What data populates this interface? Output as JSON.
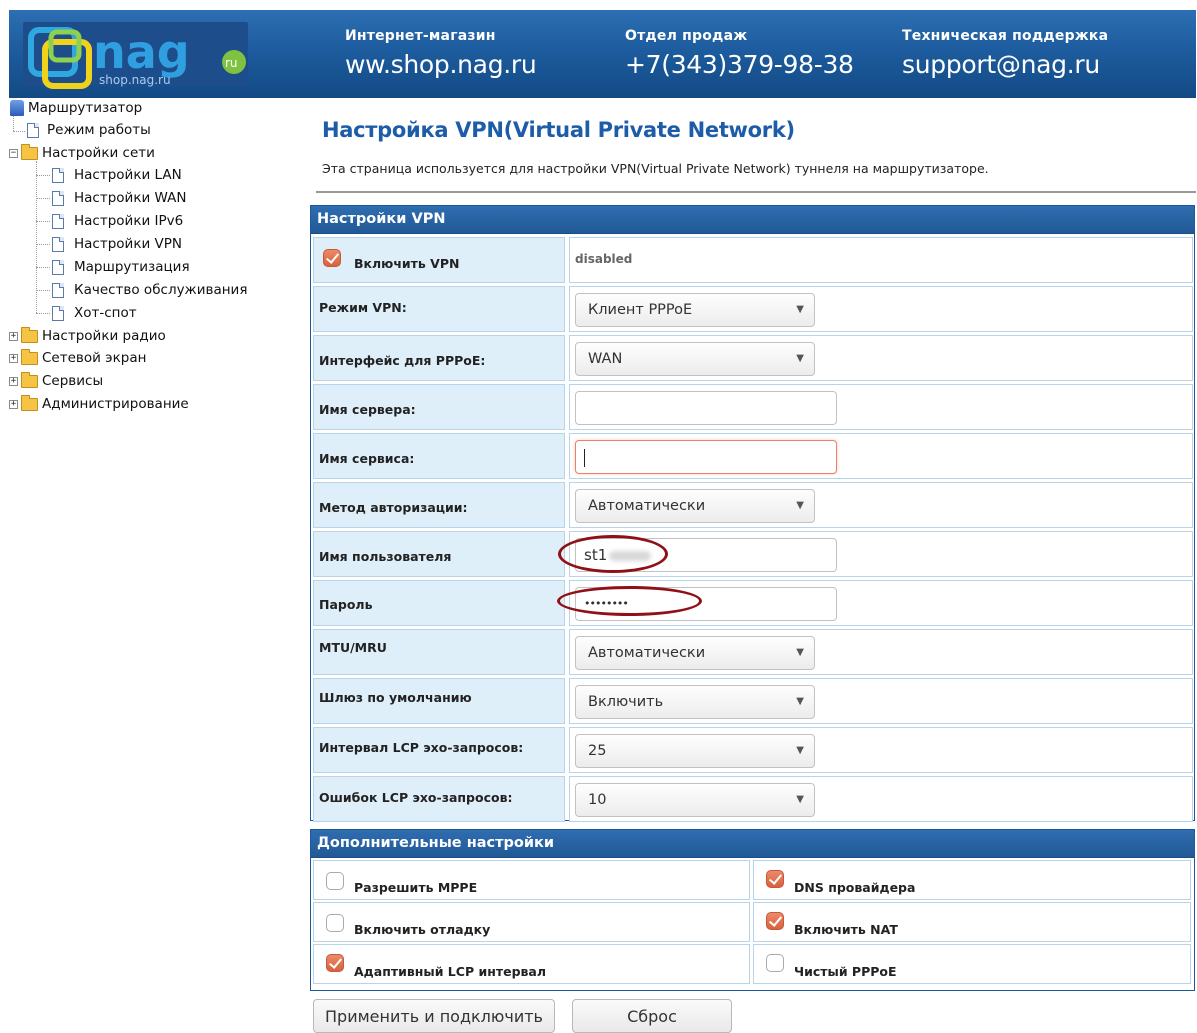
{
  "header": {
    "logo": {
      "brand": "nag",
      "subtext": "shop.nag.ru",
      "badge": "ru"
    },
    "shop": {
      "label": "Интернет-магазин",
      "value": "ww.shop.nag.ru"
    },
    "sales": {
      "label": "Отдел продаж",
      "value": "+7(343)379-98-38"
    },
    "support": {
      "label": "Техническая поддержка",
      "value": "support@nag.ru"
    }
  },
  "tree": {
    "root": "Маршрутизатор",
    "mode": "Режим работы",
    "net": "Настройки сети",
    "lan": "Настройки LAN",
    "wan": "Настройки WAN",
    "ipv6": "Настройки IPv6",
    "vpn": "Настройки VPN",
    "routing": "Маршрутизация",
    "qos": "Качество обслуживания",
    "hotspot": "Хот-спот",
    "radio": "Настройки радио",
    "firewall": "Сетевой экран",
    "services": "Сервисы",
    "admin": "Администрирование"
  },
  "page": {
    "title": "Настройка VPN(Virtual Private Network)",
    "description": "Эта страница используется для настройки VPN(Virtual Private Network) туннеля на маршрутизаторе."
  },
  "vpn": {
    "header": "Настройки VPN",
    "enable_label": "Включить VPN",
    "status": "disabled",
    "mode_label": "Режим VPN:",
    "mode_value": "Клиент PPPoE",
    "iface_label": "Интерфейс для PPPoE:",
    "iface_value": "WAN",
    "server_label": "Имя сервера:",
    "server_value": "",
    "service_label": "Имя сервиса:",
    "service_value": "",
    "auth_label": "Метод авторизации:",
    "auth_value": "Автоматически",
    "user_label": "Имя пользователя",
    "user_value": "st1",
    "pass_label": "Пароль",
    "pass_value": "••••••••",
    "mtu_label": "MTU/MRU",
    "mtu_value": "Автоматически",
    "gw_label": "Шлюз по умолчанию",
    "gw_value": "Включить",
    "lcp_int_label": "Интервал LCP эхо-запросов:",
    "lcp_int_value": "25",
    "lcp_err_label": "Ошибок LCP эхо-запросов:",
    "lcp_err_value": "10"
  },
  "extra": {
    "header": "Дополнительные настройки",
    "mppe": "Разрешить MPPE",
    "dns": "DNS провайдера",
    "debug": "Включить отладку",
    "nat": "Включить NAT",
    "adaptive": "Адаптивный LCP интервал",
    "pure": "Чистый PPPoE"
  },
  "buttons": {
    "apply": "Применить и подключить",
    "reset": "Сброс"
  },
  "colors": {
    "accent": "#1d5ca8",
    "header_bg": "#1d5c9e",
    "checkbox_on": "#d9613d",
    "annotation": "#8f1116"
  }
}
